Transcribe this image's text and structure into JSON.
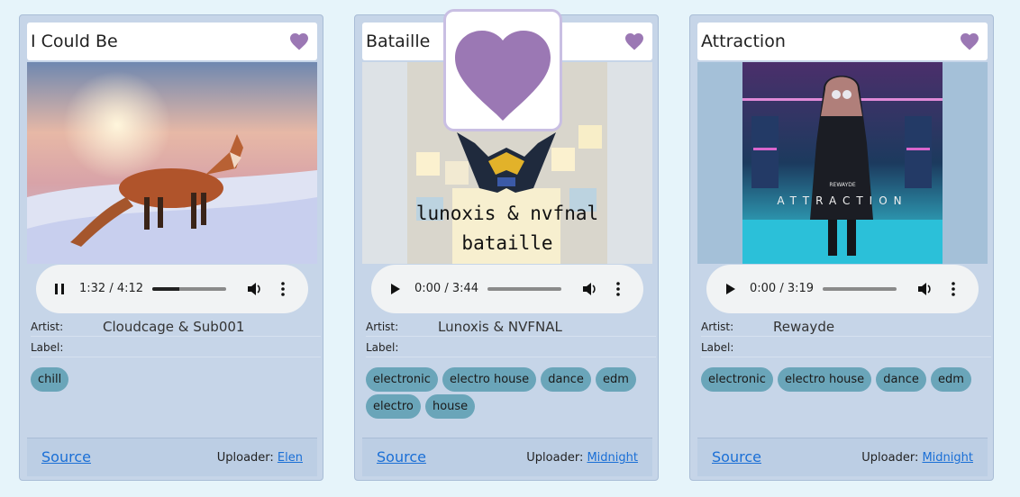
{
  "colors": {
    "heart": "#9b78b4",
    "tag": "#6aa5b9",
    "link": "#1a6fd6",
    "card": "#c6d5e8"
  },
  "cards": [
    {
      "title": "I Could Be",
      "player": {
        "time": "1:32 / 4:12",
        "progress": 0.37,
        "state": "playing"
      },
      "artist_label": "Artist:",
      "artist": "Cloudcage & Sub001",
      "label_label": "Label:",
      "label": "",
      "tags": [
        "chill"
      ],
      "source": "Source",
      "uploader_label": "Uploader:",
      "uploader": "Elen"
    },
    {
      "title": "Bataille",
      "player": {
        "time": "0:00 / 3:44",
        "progress": 0.0,
        "state": "paused"
      },
      "artist_label": "Artist:",
      "artist": "Lunoxis & NVFNAL",
      "label_label": "Label:",
      "label": "",
      "tags": [
        "electronic",
        "electro house",
        "dance",
        "edm",
        "electro",
        "house"
      ],
      "art_text_1": "lunoxis & nvfnal",
      "art_text_2": "bataille",
      "source": "Source",
      "uploader_label": "Uploader:",
      "uploader": "Midnight"
    },
    {
      "title": "Attraction",
      "player": {
        "time": "0:00 / 3:19",
        "progress": 0.0,
        "state": "paused"
      },
      "artist_label": "Artist:",
      "artist": "Rewayde",
      "label_label": "Label:",
      "label": "",
      "tags": [
        "electronic",
        "electro house",
        "dance",
        "edm"
      ],
      "art_text_1": "REWAYDE",
      "art_text_2": "ATTRACTION",
      "source": "Source",
      "uploader_label": "Uploader:",
      "uploader": "Midnight"
    }
  ],
  "icons": {
    "favorite": "heart-icon",
    "play": "play-icon",
    "pause": "pause-icon",
    "volume": "volume-icon",
    "more": "more-vert-icon"
  }
}
